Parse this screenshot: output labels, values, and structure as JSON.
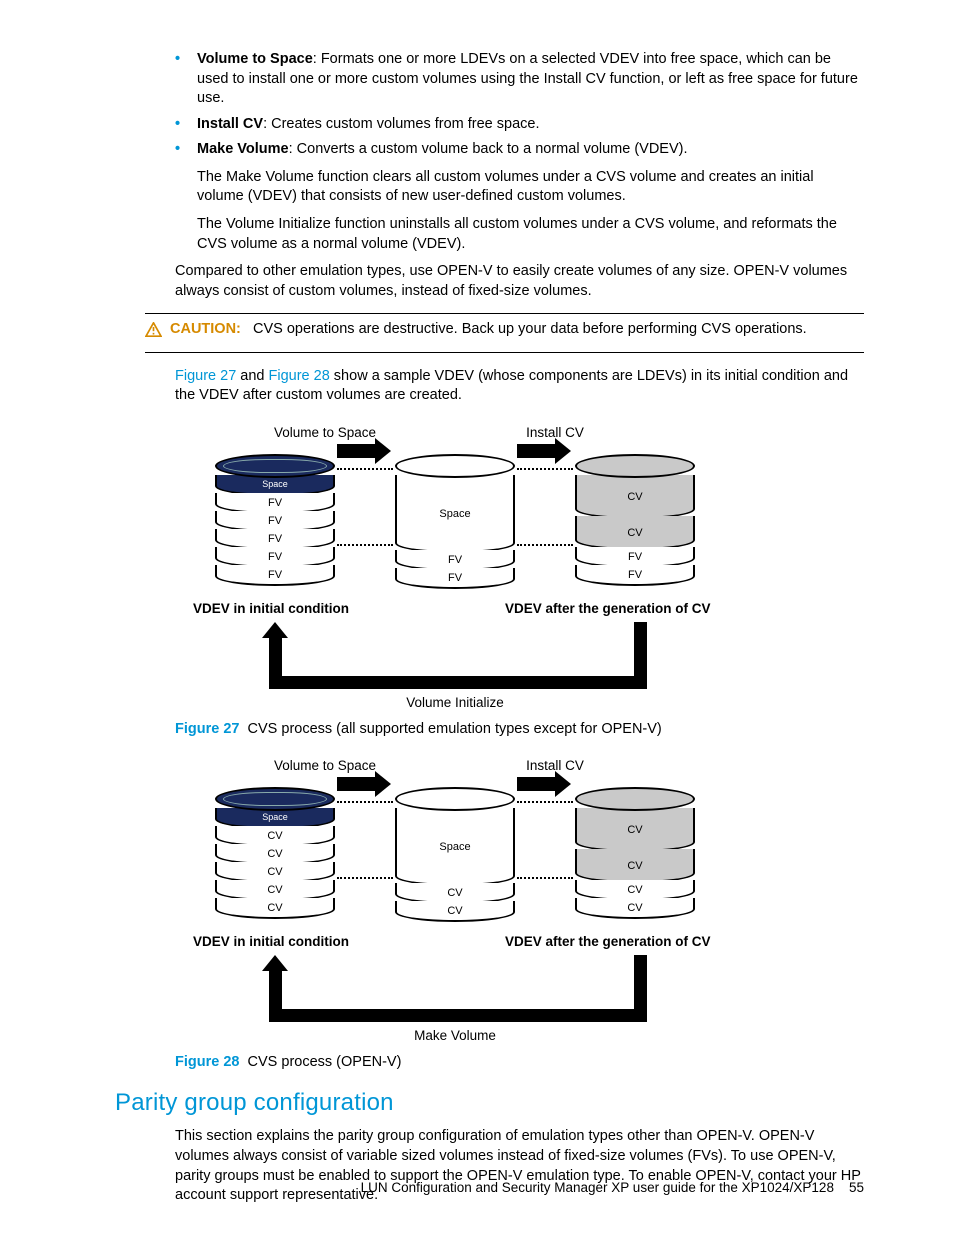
{
  "bullets": [
    {
      "term": "Volume to Space",
      "desc": ": Formats one or more LDEVs on a selected VDEV into free space, which can be used to install one or more custom volumes using the Install CV function, or left as free space for future use."
    },
    {
      "term": "Install CV",
      "desc": ": Creates custom volumes from free space."
    },
    {
      "term": "Make Volume",
      "desc": ": Converts a custom volume back to a normal volume (VDEV)."
    }
  ],
  "make_volume_sub": [
    "The Make Volume function clears all custom volumes under a CVS volume and creates an initial volume (VDEV) that consists of new user-defined custom volumes.",
    "The Volume Initialize function uninstalls all custom volumes under a CVS volume, and reformats the CVS volume as a normal volume (VDEV)."
  ],
  "compared_para": "Compared to other emulation types, use OPEN-V to easily create volumes of any size. OPEN-V volumes always consist of custom volumes, instead of fixed-size volumes.",
  "caution": {
    "label": "CAUTION:",
    "text": "CVS operations are destructive. Back up your data before performing CVS operations."
  },
  "figref": {
    "fig27": "Figure 27",
    "fig28": "Figure 28",
    "sentence_mid": " and ",
    "sentence_tail": " show a sample VDEV (whose components are LDEVs) in its initial condition and the VDEV after custom volumes are created."
  },
  "figure27": {
    "num": "Figure 27",
    "caption": "CVS process (all supported emulation types except for OPEN-V)",
    "top_left": "Volume to Space",
    "top_right": "Install CV",
    "left_caption": "VDEV in initial condition",
    "right_caption": "VDEV after the generation of CV",
    "bottom": "Volume Initialize",
    "space_label": "Space",
    "space_small": "Space",
    "slabs_left": [
      "FV",
      "FV",
      "FV",
      "FV",
      "FV"
    ],
    "slabs_mid": [
      "FV",
      "FV"
    ],
    "slabs_right": [
      "CV",
      "CV",
      "FV",
      "FV"
    ]
  },
  "figure28": {
    "num": "Figure 28",
    "caption": "CVS process (OPEN-V)",
    "top_left": "Volume to Space",
    "top_right": "Install CV",
    "left_caption": "VDEV in initial condition",
    "right_caption": "VDEV after the generation of CV",
    "bottom": "Make Volume",
    "space_label": "Space",
    "space_small": "Space",
    "slabs_left": [
      "CV",
      "CV",
      "CV",
      "CV",
      "CV"
    ],
    "slabs_mid": [
      "CV",
      "CV"
    ],
    "slabs_right": [
      "CV",
      "CV",
      "CV",
      "CV"
    ]
  },
  "section": {
    "heading": "Parity group configuration",
    "para": "This section explains the parity group configuration of emulation types other than OPEN-V. OPEN-V volumes always consist of variable sized volumes instead of fixed-size volumes (FVs). To use OPEN-V, parity groups must be enabled to support the OPEN-V emulation type. To enable OPEN-V, contact your HP account support representative."
  },
  "footer": {
    "title": "LUN Configuration and Security Manager XP user guide for the XP1024/XP128",
    "page": "55"
  }
}
